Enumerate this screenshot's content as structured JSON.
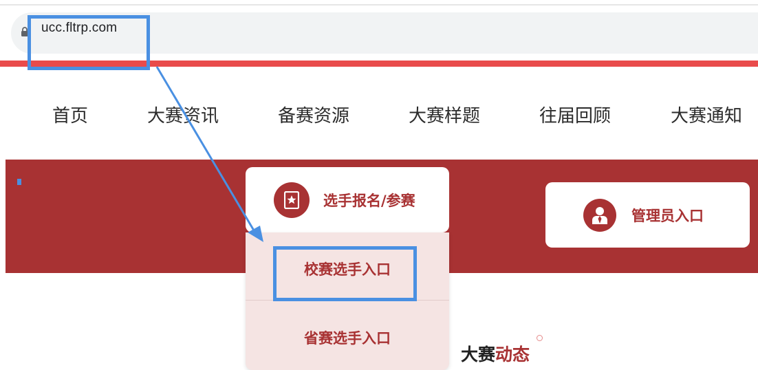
{
  "browser": {
    "url": "ucc.fltrp.com"
  },
  "nav": {
    "items": [
      "首页",
      "大赛资讯",
      "备赛资源",
      "大赛样题",
      "往届回顾",
      "大赛通知"
    ]
  },
  "entry": {
    "player_label": "选手报名/参赛",
    "admin_label": "管理员入口",
    "player_icon": "bookmark-star-icon",
    "admin_icon": "user-badge-icon"
  },
  "dropdown": {
    "items": [
      "校赛选手入口",
      "省赛选手入口"
    ]
  },
  "section": {
    "title_part1": "大赛",
    "title_part2": "动态"
  },
  "colors": {
    "brand_red": "#a83233",
    "header_stripe": "#e94b4b",
    "highlight_blue": "#4a90e2",
    "dropdown_bg": "#f5e4e3"
  }
}
